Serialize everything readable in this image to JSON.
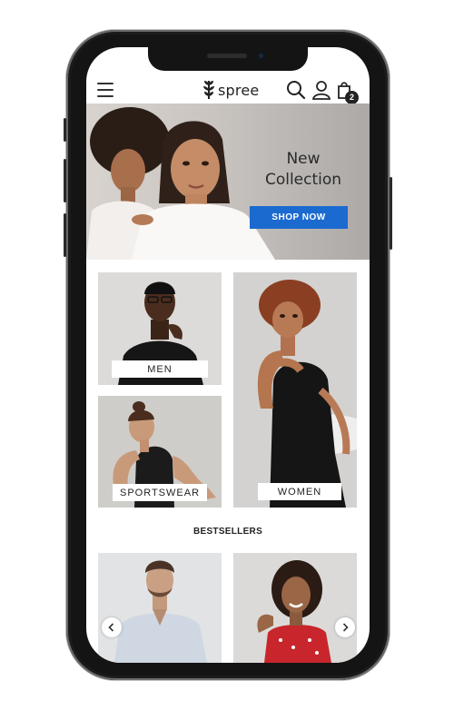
{
  "app": {
    "logo_text": "spree"
  },
  "header": {
    "cart_count": "2",
    "icons": [
      "hamburger-icon",
      "spree-logo-icon",
      "search-icon",
      "user-icon",
      "cart-icon"
    ]
  },
  "hero": {
    "title_line1": "New",
    "title_line2": "Collection",
    "cta_label": "SHOP NOW",
    "cta_color": "#1b6ad0"
  },
  "categories": [
    {
      "label": "MEN"
    },
    {
      "label": "WOMEN"
    },
    {
      "label": "SPORTSWEAR"
    }
  ],
  "bestsellers": {
    "title": "BESTSELLERS",
    "nav": [
      "chevron-left-icon",
      "chevron-right-icon"
    ]
  }
}
